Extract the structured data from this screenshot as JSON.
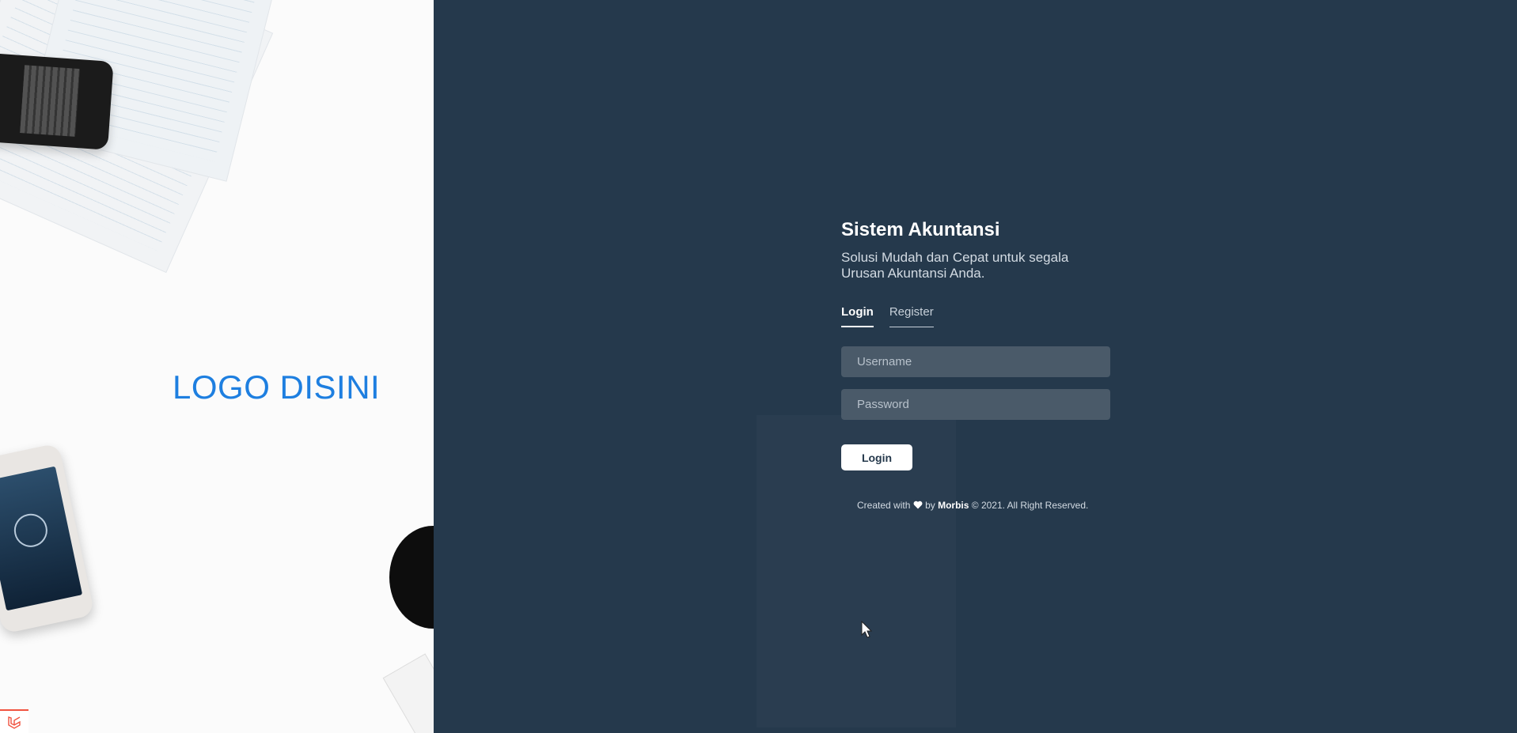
{
  "brand": {
    "logo_text": "LOGO DISINI",
    "logo_color": "#1e7fe0"
  },
  "auth": {
    "title": "Sistem Akuntansi",
    "subtitle": "Solusi Mudah dan Cepat untuk segala Urusan Akuntansi Anda.",
    "tabs": [
      {
        "label": "Login",
        "active": true
      },
      {
        "label": "Register",
        "active": false
      }
    ],
    "username_placeholder": "Username",
    "password_placeholder": "Password",
    "submit_label": "Login"
  },
  "footer": {
    "prefix": "Created with",
    "icon": "heart-icon",
    "by": "by",
    "author": "Morbis",
    "suffix": "© 2021. All Right Reserved."
  },
  "colors": {
    "panel_background": "#25394c",
    "input_background": "#4a5a69",
    "left_background": "#fbfbfb",
    "framework_badge": "#f05340"
  },
  "icons": {
    "framework_badge": "laravel-icon",
    "pointer": "cursor-icon"
  }
}
